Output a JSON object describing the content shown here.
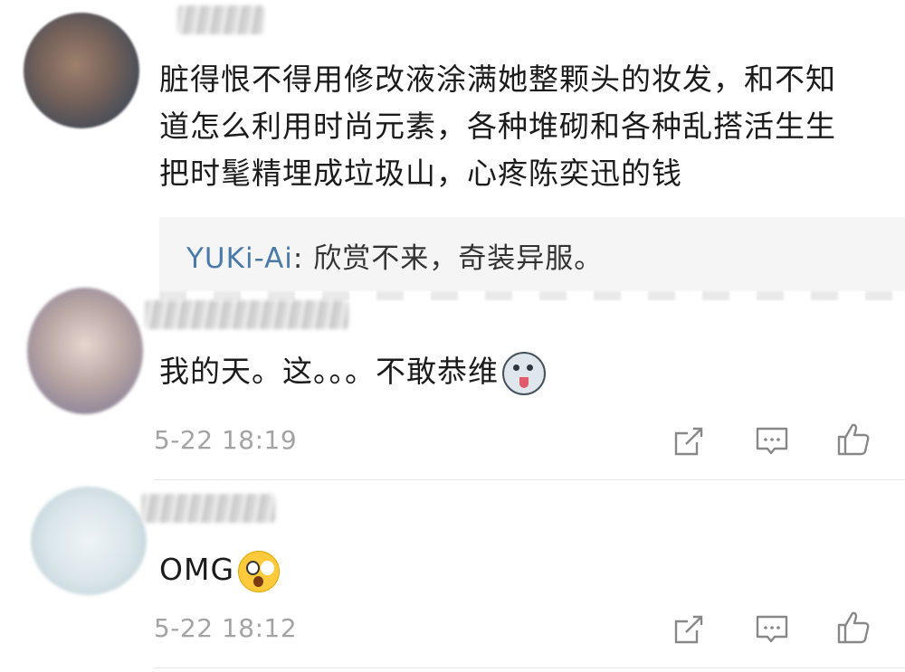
{
  "comments": [
    {
      "lines": [
        "脏得恨不得用修改液涂满她整颗头的妆发，和不知",
        "道怎么利用时尚元素，各种堆砌和各种乱搭活生生",
        "把时髦精埋成垃圾山，心疼陈奕迅的钱"
      ],
      "reply": {
        "user": "YUKi-Ai",
        "text": ": 欣赏不来，奇装异服。"
      }
    },
    {
      "text": "我的天。这。。。不敢恭维",
      "emoji": "husky-emoji",
      "time": "5-22 18:19"
    },
    {
      "text": "OMG",
      "emoji": "shocked-face-emoji",
      "time": "5-22 18:12"
    }
  ],
  "icons": [
    "share-icon",
    "comment-icon",
    "like-icon"
  ],
  "colors": {
    "link": "#4a7aa8",
    "meta": "#a3a3a3",
    "reply_bg": "#f5f5f5"
  }
}
